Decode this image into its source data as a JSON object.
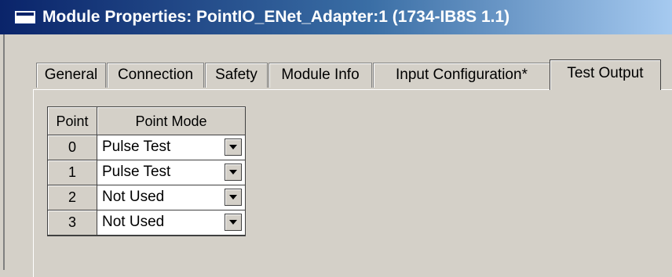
{
  "window": {
    "title": "Module Properties: PointIO_ENet_Adapter:1 (1734-IB8S 1.1)"
  },
  "tabs": [
    {
      "label": "General"
    },
    {
      "label": "Connection"
    },
    {
      "label": "Safety"
    },
    {
      "label": "Module Info"
    },
    {
      "label": "Input Configuration*"
    },
    {
      "label": "Test Output",
      "active": true
    }
  ],
  "table": {
    "columns": [
      "Point",
      "Point Mode"
    ],
    "rows": [
      {
        "point": "0",
        "mode": "Pulse Test"
      },
      {
        "point": "1",
        "mode": "Pulse Test"
      },
      {
        "point": "2",
        "mode": "Not Used"
      },
      {
        "point": "3",
        "mode": "Not Used"
      }
    ]
  },
  "colors": {
    "titlebar_start": "#0a246a",
    "titlebar_end": "#a6caf0",
    "dialog_bg": "#d4d0c8"
  }
}
